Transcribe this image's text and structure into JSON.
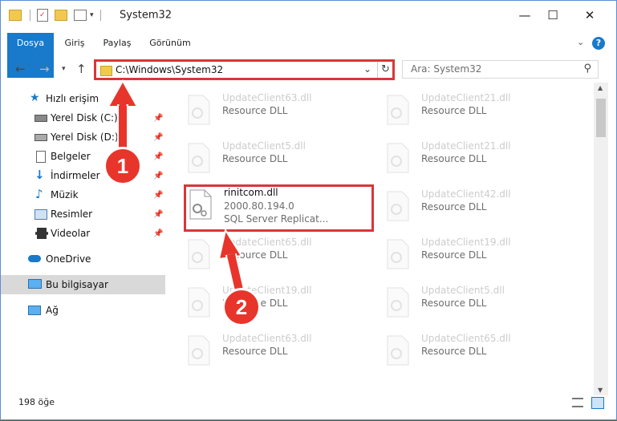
{
  "window": {
    "title": "System32",
    "quick_access": [
      "folder-icon",
      "properties-icon",
      "new-folder-icon",
      "customize-icon"
    ]
  },
  "ribbon": {
    "tabs": [
      "Dosya",
      "Giriş",
      "Paylaş",
      "Görünüm"
    ]
  },
  "nav": {
    "address": "C:\\Windows\\System32",
    "search_placeholder": "Ara: System32"
  },
  "sidebar": {
    "items": [
      {
        "label": "Hızlı erişim",
        "icon": "star-icon"
      },
      {
        "label": "Yerel Disk (C:)",
        "icon": "drive-icon",
        "pinned": true
      },
      {
        "label": "Yerel Disk (D:)",
        "icon": "drive-icon",
        "pinned": true
      },
      {
        "label": "Belgeler",
        "icon": "documents-icon",
        "pinned": true
      },
      {
        "label": "İndirmeler",
        "icon": "downloads-icon",
        "pinned": true
      },
      {
        "label": "Müzik",
        "icon": "music-icon",
        "pinned": true
      },
      {
        "label": "Resimler",
        "icon": "pictures-icon",
        "pinned": true
      },
      {
        "label": "Videolar",
        "icon": "videos-icon",
        "pinned": true
      },
      {
        "label": "OneDrive",
        "icon": "cloud-icon"
      },
      {
        "label": "Bu bilgisayar",
        "icon": "computer-icon",
        "selected": true
      },
      {
        "label": "Ağ",
        "icon": "network-icon"
      }
    ]
  },
  "files": {
    "highlighted": {
      "name": "rinitcom.dll",
      "version": "2000.80.194.0",
      "description": "SQL Server Replicat..."
    },
    "left_column": [
      {
        "name": "UpdateClient63.dll",
        "desc": "Resource DLL"
      },
      {
        "name": "UpdateClient5.dll",
        "desc": "Resource DLL"
      },
      {
        "name": "UpdateClient65.dll",
        "desc": "Resource DLL"
      },
      {
        "name": "UpdateClient19.dll",
        "desc": "Resource DLL"
      },
      {
        "name": "UpdateClient63.dll",
        "desc": "Resource DLL"
      }
    ],
    "right_column": [
      {
        "name": "UpdateClient21.dll",
        "desc": "Resource DLL"
      },
      {
        "name": "UpdateClient21.dll",
        "desc": "Resource DLL"
      },
      {
        "name": "UpdateClient42.dll",
        "desc": "Resource DLL"
      },
      {
        "name": "UpdateClient19.dll",
        "desc": "Resource DLL"
      },
      {
        "name": "UpdateClient5.dll",
        "desc": "Resource DLL"
      },
      {
        "name": "UpdateClient65.dll",
        "desc": "Resource DLL"
      }
    ]
  },
  "status": {
    "item_count": "198 öğe"
  },
  "annotations": {
    "step1": "1",
    "step2": "2",
    "color": "#e8352b"
  }
}
